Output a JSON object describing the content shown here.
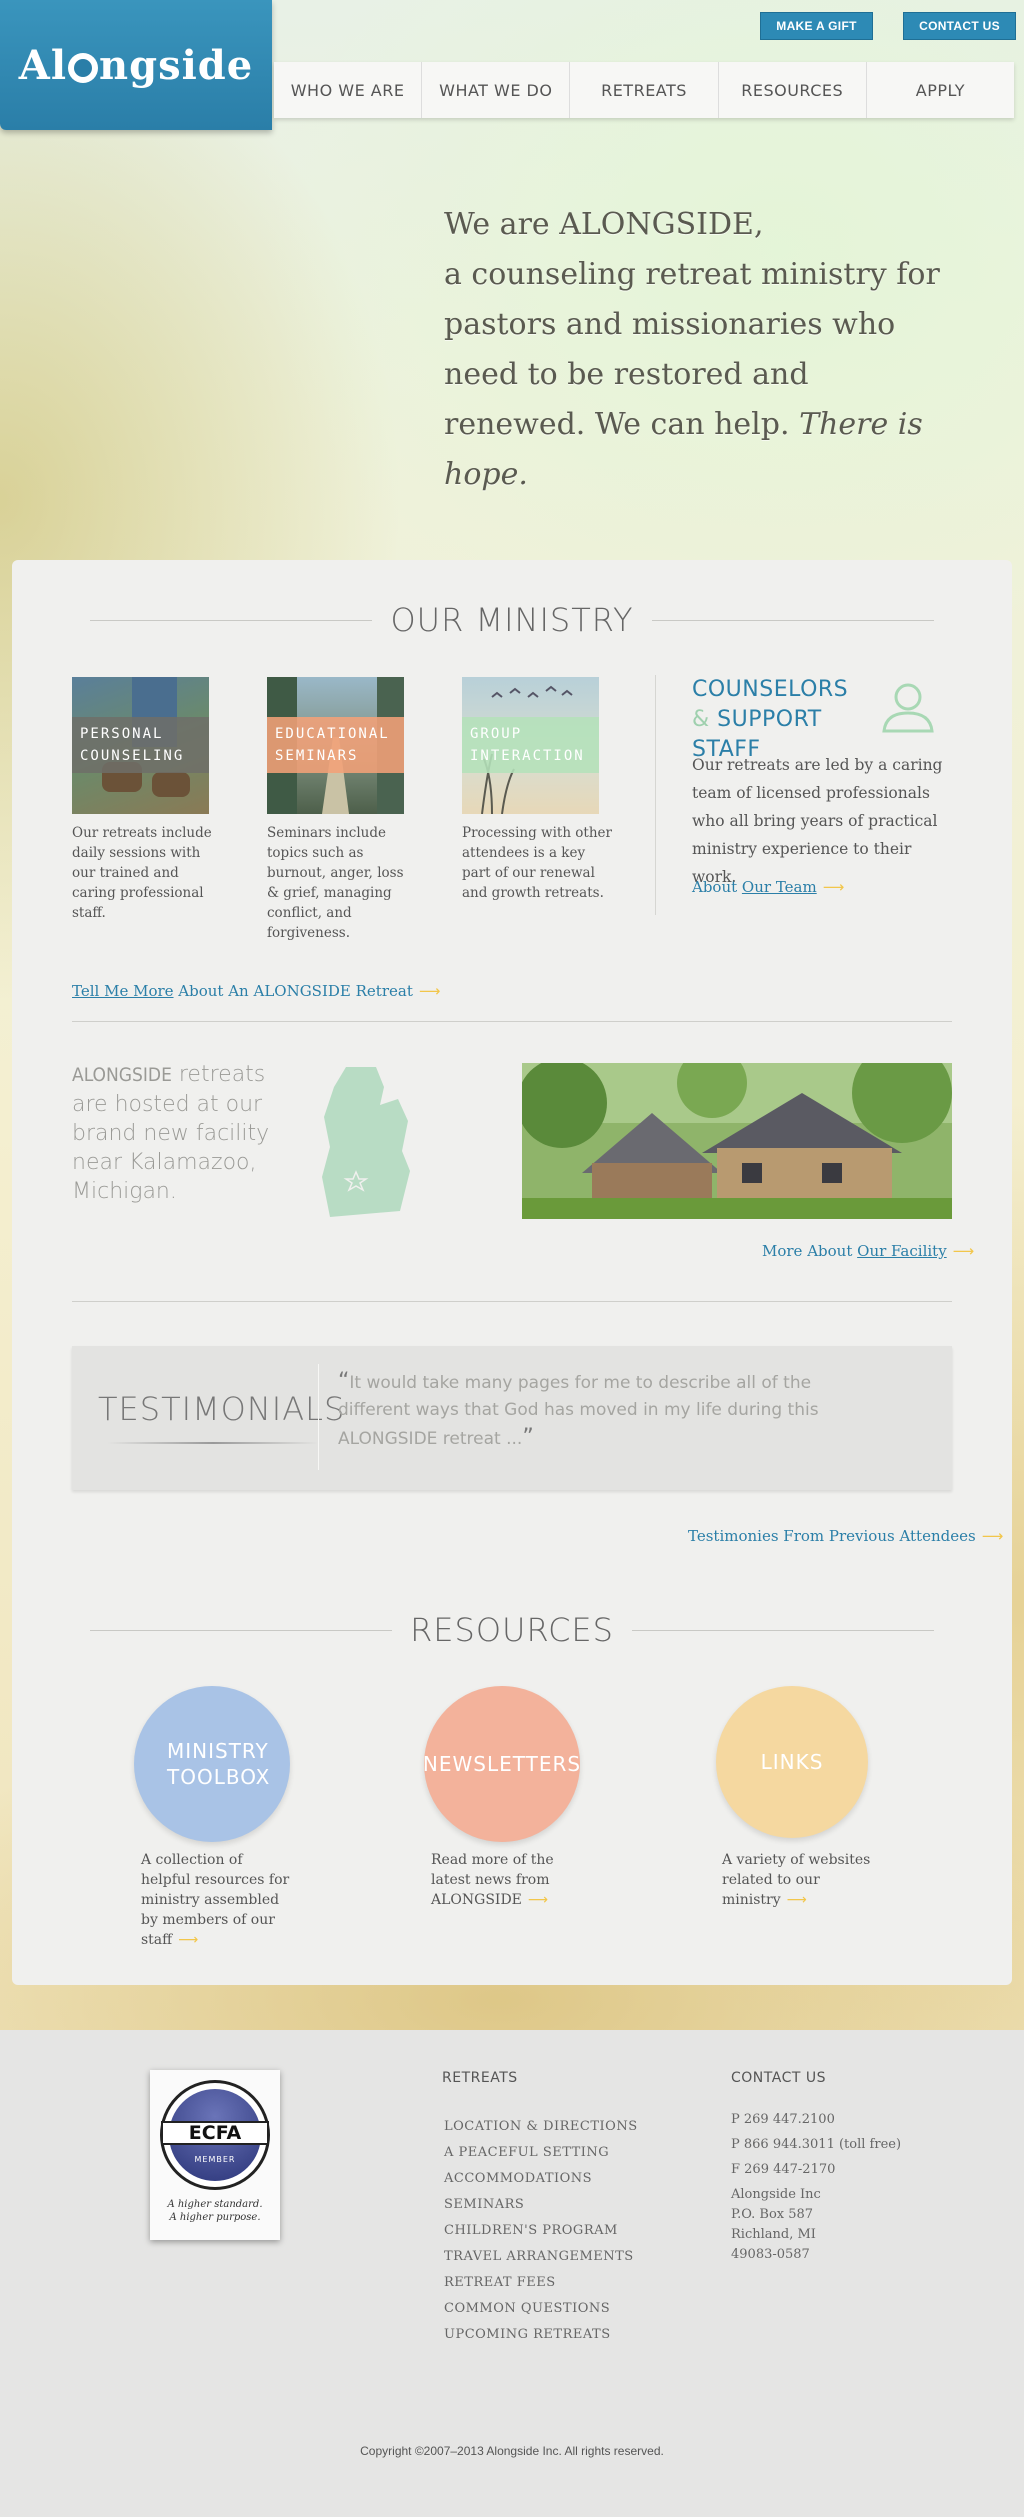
{
  "header": {
    "logo_text_a": "Al",
    "logo_text_b": "ngside",
    "make_gift": "MAKE A GIFT",
    "contact_us": "CONTACT US",
    "nav": [
      "WHO WE ARE",
      "WHAT WE DO",
      "RETREATS",
      "RESOURCES",
      "APPLY"
    ]
  },
  "hero": {
    "line1": "We are ALONGSIDE,",
    "line2": "a counseling retreat ministry for pastors and missionaries who need to be restored and renewed. We can help.",
    "emphasis": "There is hope."
  },
  "ministry": {
    "title": "OUR MINISTRY",
    "tiles": [
      {
        "label": "PERSONAL COUNSELING",
        "desc": "Our retreats include daily sessions with our trained and caring professional staff."
      },
      {
        "label": "EDUCATIONAL SEMINARS",
        "desc": "Seminars include topics such as burnout, anger, loss & grief, managing conflict, and forgiveness."
      },
      {
        "label": "GROUP INTERACTION",
        "desc": "Processing with other attendees is a key part of our renewal and growth retreats."
      }
    ],
    "counselors_title_a": "COUNSELORS",
    "counselors_title_amp": "&",
    "counselors_title_b": "SUPPORT STAFF",
    "counselors_desc": "Our retreats are led by a caring team of licensed professionals who all bring years of practical ministry experience to their work.",
    "counselors_link_a": "About ",
    "counselors_link_b": "Our Team",
    "tell_more_a": "Tell Me More",
    "tell_more_b": " About An ALONGSIDE Retreat"
  },
  "facility": {
    "brand": "ALONGSIDE",
    "text": " retreats are hosted at our brand new facility near Kalamazoo, Michigan.",
    "link_a": "More About ",
    "link_b": "Our Facility"
  },
  "testimonials": {
    "title": "TESTIMONIALS",
    "quote": "It would take many pages for me to describe all of the different ways that God has moved in my life during this ALONGSIDE retreat ...",
    "link": "Testimonies From Previous Attendees"
  },
  "resources": {
    "title": "RESOURCES",
    "items": [
      {
        "label": "MINISTRY TOOLBOX",
        "desc": "A collection of helpful resources for ministry assembled by members of our staff",
        "color": "#a9c3e6"
      },
      {
        "label": "NEWSLETTERS",
        "desc": "Read more of the latest news from ALONGSIDE",
        "color": "#f3b29b"
      },
      {
        "label": "LINKS",
        "desc": "A variety of websites related to our ministry",
        "color": "#f5d8a0"
      }
    ]
  },
  "footer": {
    "ecfa": "ECFA",
    "ecfa_member": "MEMBER",
    "ecfa_tag1": "A higher standard.",
    "ecfa_tag2": "A higher purpose.",
    "retreats_head": "RETREATS",
    "retreats": [
      "LOCATION & DIRECTIONS",
      "A PEACEFUL SETTING",
      "ACCOMMODATIONS",
      "SEMINARS",
      "CHILDREN'S PROGRAM",
      "TRAVEL ARRANGEMENTS",
      "RETREAT FEES",
      "COMMON QUESTIONS",
      "UPCOMING RETREATS"
    ],
    "contact_head": "CONTACT US",
    "phone": "P 269 447.2100",
    "tollfree": "P 866 944.3011 (toll free)",
    "fax": "F 269 447-2170",
    "addr1": "Alongside Inc",
    "addr2": "P.O. Box 587",
    "addr3": "Richland, MI",
    "addr4": "49083-0587",
    "copyright": "Copyright ©2007–2013 Alongside Inc. All rights reserved."
  },
  "colors": {
    "brand_blue": "#2d8ab5",
    "accent_yellow": "#f2c64a"
  }
}
